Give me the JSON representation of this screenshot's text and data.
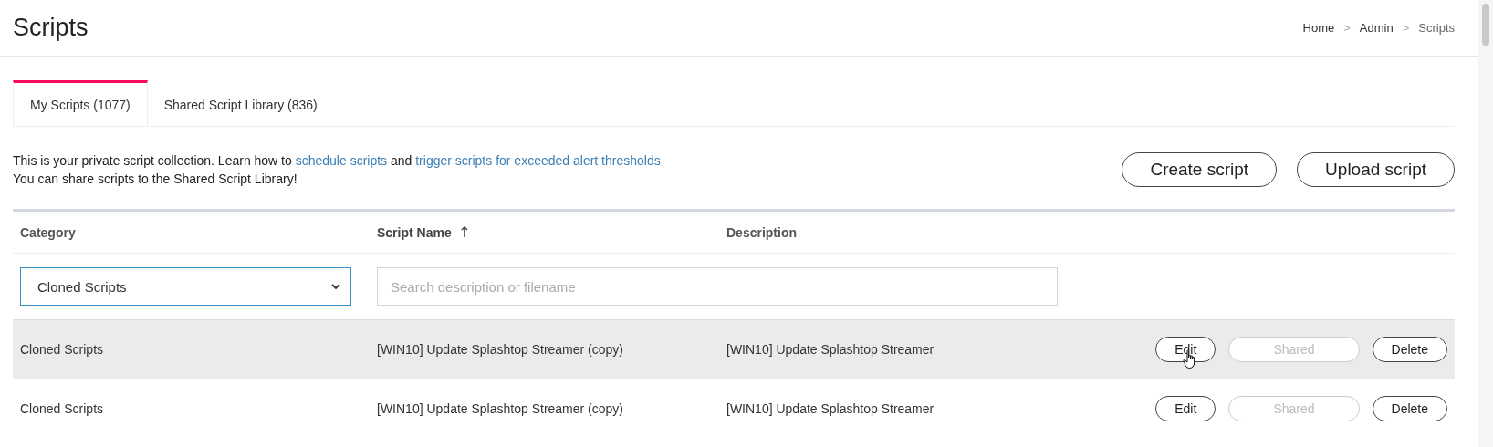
{
  "page": {
    "title": "Scripts"
  },
  "breadcrumb": [
    {
      "label": "Home",
      "current": false
    },
    {
      "label": "Admin",
      "current": false
    },
    {
      "label": "Scripts",
      "current": true
    }
  ],
  "breadcrumb_separator": ">",
  "tabs": [
    {
      "label": "My Scripts (1077)",
      "selected": true
    },
    {
      "label": "Shared Script Library (836)",
      "selected": false
    }
  ],
  "intro": {
    "parts": [
      {
        "kind": "text",
        "text": "This is your private script collection. Learn how to "
      },
      {
        "kind": "link",
        "text": "schedule scripts"
      },
      {
        "kind": "text",
        "text": " and "
      },
      {
        "kind": "link",
        "text": "trigger scripts for exceeded alert thresholds"
      }
    ],
    "second_line": "You can share scripts to the Shared Script Library!"
  },
  "actions": [
    "Create script",
    "Upload script"
  ],
  "table": {
    "columns": [
      {
        "label": "Category",
        "sorted": false
      },
      {
        "label": "Script Name",
        "sorted": true
      },
      {
        "label": "Description",
        "sorted": false
      }
    ],
    "category_filter": {
      "value": "Cloned Scripts"
    },
    "search": {
      "placeholder": "Search description or filename"
    },
    "rows": [
      {
        "category": "Cloned Scripts",
        "name": "[WIN10] Update Splashtop Streamer (copy)",
        "description": "[WIN10] Update Splashtop Streamer",
        "hovered": true,
        "buttons": [
          {
            "label": "Edit",
            "disabled": false
          },
          {
            "label": "Shared",
            "disabled": true
          },
          {
            "label": "Delete",
            "disabled": false
          }
        ]
      },
      {
        "category": "Cloned Scripts",
        "name": "[WIN10] Update Splashtop Streamer (copy)",
        "description": "[WIN10] Update Splashtop Streamer",
        "hovered": false,
        "buttons": [
          {
            "label": "Edit",
            "disabled": false
          },
          {
            "label": "Shared",
            "disabled": true
          },
          {
            "label": "Delete",
            "disabled": false
          }
        ]
      }
    ]
  }
}
